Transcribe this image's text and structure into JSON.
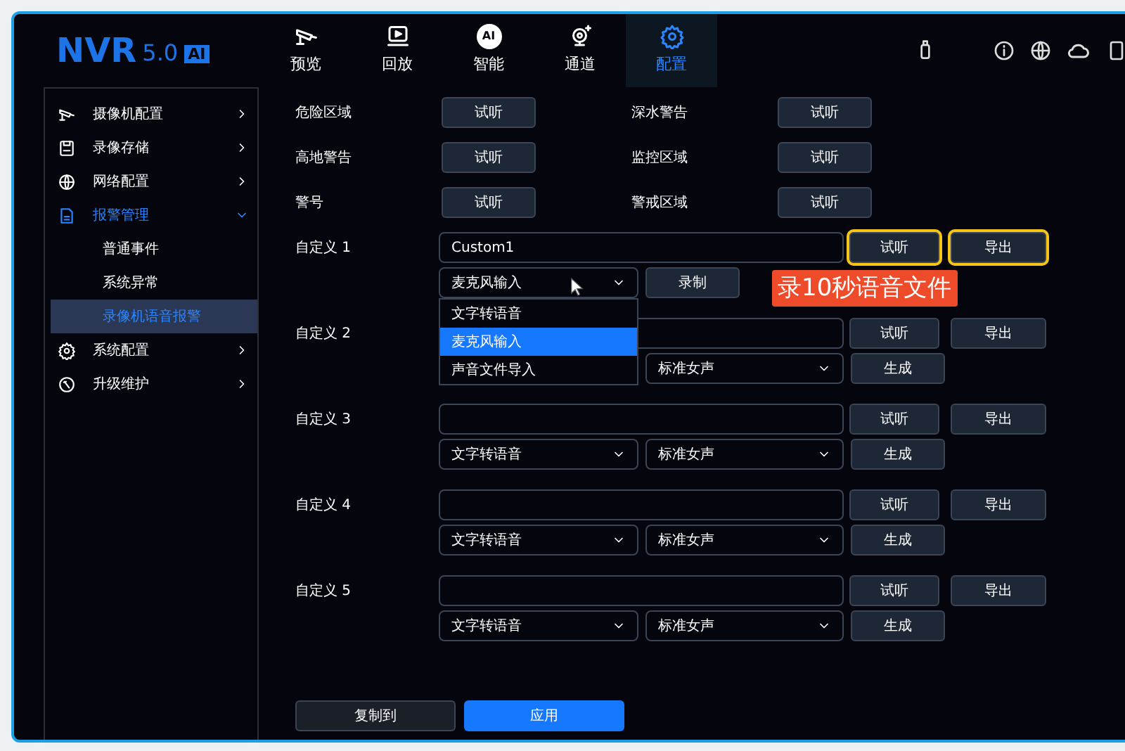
{
  "header": {
    "logo": {
      "text": "NVR",
      "version": "5.0",
      "badge": "AI"
    },
    "tabs": [
      {
        "label": "预览",
        "selected": false
      },
      {
        "label": "回放",
        "selected": false
      },
      {
        "label": "智能",
        "icon_text": "AI",
        "selected": false
      },
      {
        "label": "通道",
        "selected": false
      },
      {
        "label": "配置",
        "selected": true
      }
    ]
  },
  "sidebar": {
    "items": [
      {
        "label": "摄像机配置",
        "expanded": false,
        "selected": false
      },
      {
        "label": "录像存储",
        "expanded": false,
        "selected": false
      },
      {
        "label": "网络配置",
        "expanded": false,
        "selected": false
      },
      {
        "label": "报警管理",
        "expanded": true,
        "selected": true,
        "children": [
          {
            "label": "普通事件",
            "selected": false
          },
          {
            "label": "系统异常",
            "selected": false
          },
          {
            "label": "录像机语音报警",
            "selected": true
          }
        ]
      },
      {
        "label": "系统配置",
        "expanded": false,
        "selected": false
      },
      {
        "label": "升级维护",
        "expanded": false,
        "selected": false
      }
    ]
  },
  "presets": [
    {
      "label": "危险区域",
      "button": "试听"
    },
    {
      "label": "深水警告",
      "button": "试听"
    },
    {
      "label": "高地警告",
      "button": "试听"
    },
    {
      "label": "监控区域",
      "button": "试听"
    },
    {
      "label": "警号",
      "button": "试听"
    },
    {
      "label": "警戒区域",
      "button": "试听"
    }
  ],
  "customs": [
    {
      "label": "自定义 1",
      "value": "Custom1",
      "listen": "试听",
      "export": "导出",
      "highlighted": true,
      "mode": "麦克风输入",
      "action": "录制",
      "options": [
        {
          "label": "文字转语音",
          "selected": false
        },
        {
          "label": "麦克风输入",
          "selected": true
        },
        {
          "label": "声音文件导入",
          "selected": false
        }
      ]
    },
    {
      "label": "自定义 2",
      "listen": "试听",
      "export": "导出",
      "highlighted": false,
      "voice": "标准女声",
      "action": "生成"
    },
    {
      "label": "自定义 3",
      "listen": "试听",
      "export": "导出",
      "highlighted": false,
      "mode": "文字转语音",
      "voice": "标准女声",
      "action": "生成"
    },
    {
      "label": "自定义 4",
      "listen": "试听",
      "export": "导出",
      "highlighted": false,
      "mode": "文字转语音",
      "voice": "标准女声",
      "action": "生成"
    },
    {
      "label": "自定义 5",
      "listen": "试听",
      "export": "导出",
      "highlighted": false,
      "mode": "文字转语音",
      "voice": "标准女声",
      "action": "生成"
    }
  ],
  "annotation": "录10秒语音文件",
  "footer": {
    "copy": "复制到",
    "apply": "应用"
  }
}
